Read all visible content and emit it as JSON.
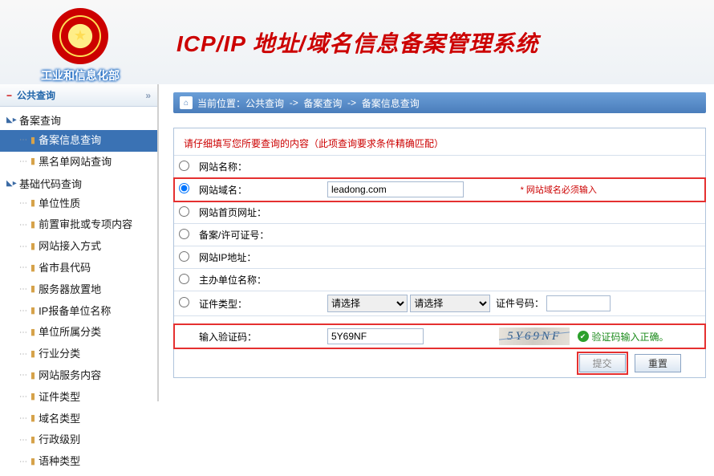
{
  "header": {
    "ministry": "工业和信息化部",
    "system_title": "ICP/IP 地址/域名信息备案管理系统"
  },
  "sidebar": {
    "title": "公共查询",
    "group1": {
      "label": "备案查询",
      "items": [
        "备案信息查询",
        "黑名单网站查询"
      ],
      "active_index": 0
    },
    "group2": {
      "label": "基础代码查询",
      "items": [
        "单位性质",
        "前置审批或专项内容",
        "网站接入方式",
        "省市县代码",
        "服务器放置地",
        "IP报备单位名称",
        "单位所属分类",
        "行业分类",
        "网站服务内容",
        "证件类型",
        "域名类型",
        "行政级别",
        "语种类型"
      ]
    }
  },
  "breadcrumb": {
    "prefix": "当前位置：",
    "parts": [
      "公共查询",
      "备案查询",
      "备案信息查询"
    ]
  },
  "form": {
    "hint": "请仔细填写您所要查询的内容（此项查询要求条件精确匹配）",
    "rows": {
      "site_name": "网站名称：",
      "site_domain": "网站域名：",
      "site_home": "网站首页网址：",
      "record_no": "备案/许可证号：",
      "site_ip": "网站IP地址：",
      "org_name": "主办单位名称：",
      "cert_type": "证件类型：",
      "captcha": "输入验证码："
    },
    "values": {
      "site_domain": "leadong.com",
      "captcha": "5Y69NF"
    },
    "select_placeholder": "请选择",
    "cert_no_label": "证件号码：",
    "required_note": "* 网站域名必须输入",
    "captcha_image_text": "5Y69NF",
    "captcha_ok": "验证码输入正确。",
    "submit": "提交",
    "reset": "重置"
  }
}
